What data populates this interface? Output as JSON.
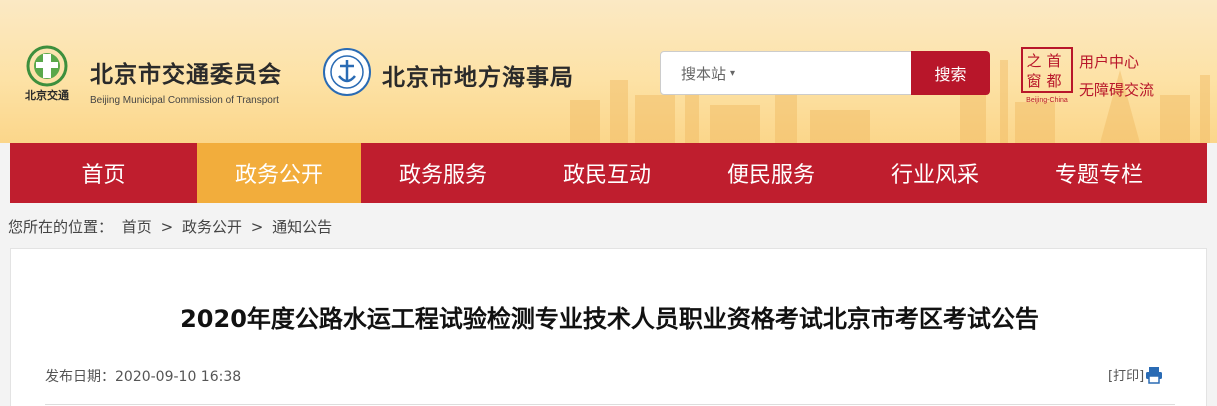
{
  "header": {
    "org1_name_cn": "北京市交通委员会",
    "org1_name_en": "Beijing Municipal Commission of Transport",
    "org1_logo_text": "北京交通",
    "org2_name_cn": "北京市地方海事局",
    "search_placeholder": "搜本站",
    "search_button": "搜索",
    "shoudu_logo_chars": [
      "首",
      "都",
      "之",
      "窗"
    ],
    "shoudu_logo_en": "Beijing-China",
    "user_center": "用户中心",
    "accessibility": "无障碍交流"
  },
  "nav": {
    "items": [
      {
        "label": "首页"
      },
      {
        "label": "政务公开"
      },
      {
        "label": "政务服务"
      },
      {
        "label": "政民互动"
      },
      {
        "label": "便民服务"
      },
      {
        "label": "行业风采"
      },
      {
        "label": "专题专栏"
      }
    ],
    "active_index": 1
  },
  "breadcrumb": {
    "prefix": "您所在的位置：",
    "items": [
      "首页",
      "政务公开",
      "通知公告"
    ],
    "separator": ">"
  },
  "article": {
    "title": "2020年度公路水运工程试验检测专业技术人员职业资格考试北京市考区考试公告",
    "date_label": "发布日期：",
    "date_value": "2020-09-10 16:38",
    "print_label": "[打印]"
  },
  "colors": {
    "brand_red": "#bf1e2e",
    "active_tab": "#f2ad3c"
  }
}
